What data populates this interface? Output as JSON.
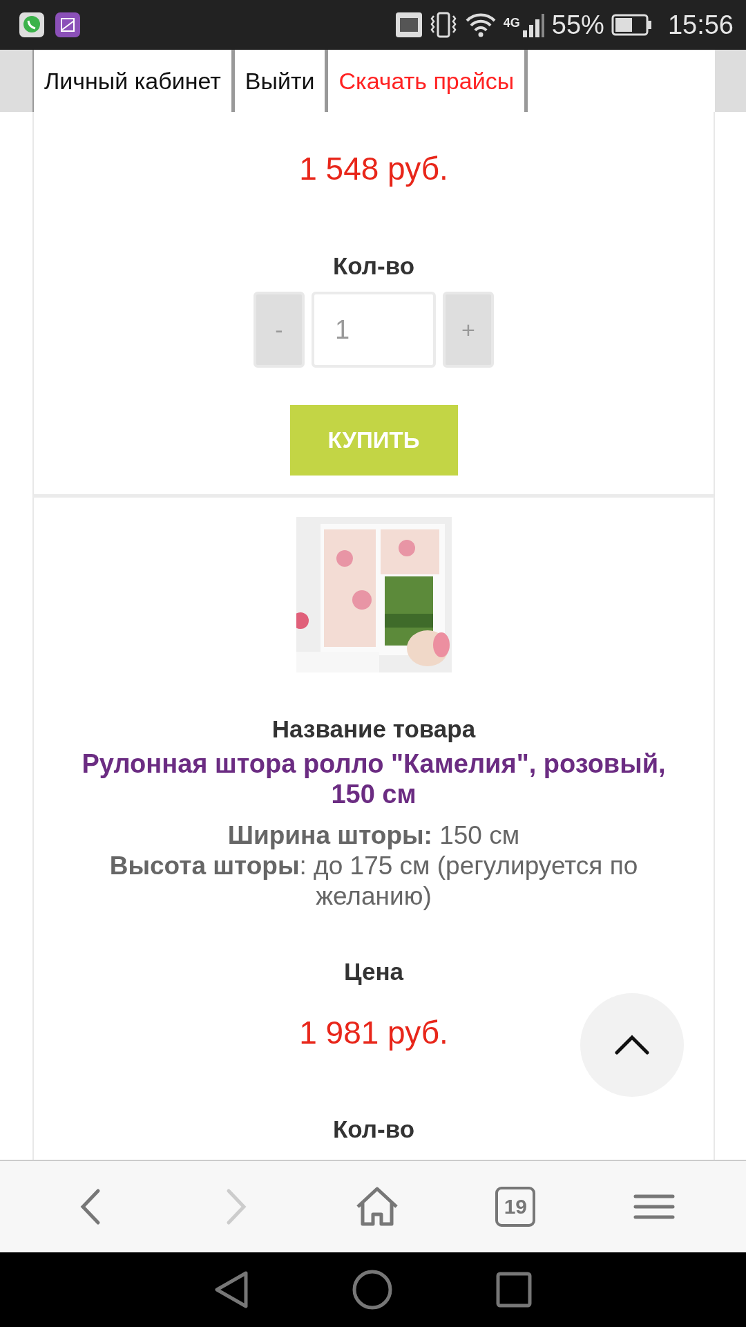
{
  "status_bar": {
    "network": "4G",
    "battery": "55%",
    "time": "15:56"
  },
  "nav_tabs": [
    {
      "label": "Личный кабинет",
      "kind": "plain"
    },
    {
      "label": "Выйти",
      "kind": "plain"
    },
    {
      "label": "Скачать прайсы",
      "kind": "accent"
    }
  ],
  "products": [
    {
      "price": "1 548 руб.",
      "quantity_label": "Кол-во",
      "quantity": {
        "minus": "-",
        "value": "1",
        "plus": "+"
      },
      "buy_label": "КУПИТЬ"
    },
    {
      "image": {
        "kind": "picture"
      },
      "name_label": "Название товара",
      "name": "Рулонная штора ролло \"Камелия\", розовый, 150 см",
      "specs": [
        "**Ширина шторы:** 150 см",
        "**Высота шторы**: до 175 см (регулируется по желанию)"
      ],
      "price_label": "Цена",
      "price": "1 981 руб.",
      "quantity_label": "Кол-во"
    }
  ],
  "browser_toolbar": {
    "tab_count": "19"
  }
}
